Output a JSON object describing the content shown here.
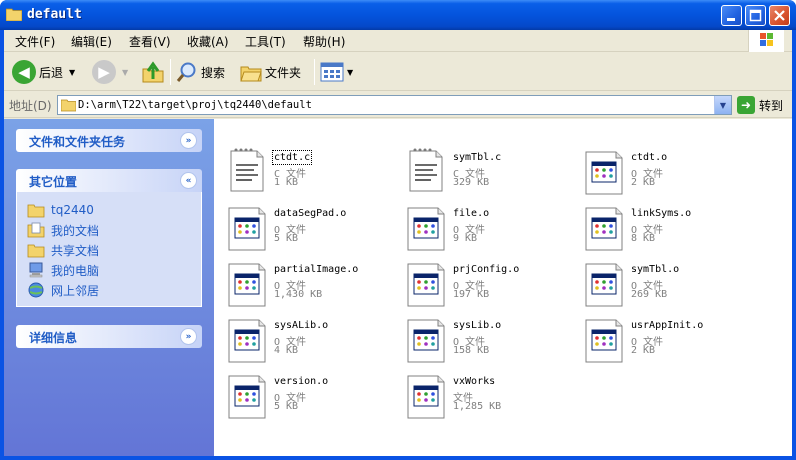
{
  "window": {
    "title": "default"
  },
  "menu": [
    "文件(F)",
    "编辑(E)",
    "查看(V)",
    "收藏(A)",
    "工具(T)",
    "帮助(H)"
  ],
  "toolbar": {
    "back": "后退",
    "search": "搜索",
    "folders": "文件夹"
  },
  "address": {
    "label": "地址(D)",
    "path": "D:\\arm\\T22\\target\\proj\\tq2440\\default",
    "go": "转到"
  },
  "tasks": {
    "title": "文件和文件夹任务"
  },
  "places": {
    "title": "其它位置",
    "items": [
      {
        "label": "tq2440",
        "icon": "folder-icon"
      },
      {
        "label": "我的文档",
        "icon": "my-documents-icon"
      },
      {
        "label": "共享文档",
        "icon": "shared-folder-icon"
      },
      {
        "label": "我的电脑",
        "icon": "my-computer-icon"
      },
      {
        "label": "网上邻居",
        "icon": "network-icon"
      }
    ]
  },
  "details": {
    "title": "详细信息"
  },
  "files": [
    {
      "name": "ctdt.c",
      "type": "C 文件",
      "size": "1 KB",
      "kind": "c"
    },
    {
      "name": "symTbl.c",
      "type": "C 文件",
      "size": "329 KB",
      "kind": "c"
    },
    {
      "name": "ctdt.o",
      "type": "O 文件",
      "size": "2 KB",
      "kind": "o"
    },
    {
      "name": "dataSegPad.o",
      "type": "O 文件",
      "size": "5 KB",
      "kind": "o"
    },
    {
      "name": "file.o",
      "type": "O 文件",
      "size": "9 KB",
      "kind": "o"
    },
    {
      "name": "linkSyms.o",
      "type": "O 文件",
      "size": "8 KB",
      "kind": "o"
    },
    {
      "name": "partialImage.o",
      "type": "O 文件",
      "size": "1,430 KB",
      "kind": "o"
    },
    {
      "name": "prjConfig.o",
      "type": "O 文件",
      "size": "197 KB",
      "kind": "o"
    },
    {
      "name": "symTbl.o",
      "type": "O 文件",
      "size": "269 KB",
      "kind": "o"
    },
    {
      "name": "sysALib.o",
      "type": "O 文件",
      "size": "4 KB",
      "kind": "o"
    },
    {
      "name": "sysLib.o",
      "type": "O 文件",
      "size": "158 KB",
      "kind": "o"
    },
    {
      "name": "usrAppInit.o",
      "type": "O 文件",
      "size": "2 KB",
      "kind": "o"
    },
    {
      "name": "version.o",
      "type": "O 文件",
      "size": "5 KB",
      "kind": "o"
    },
    {
      "name": "vxWorks",
      "type": "文件",
      "size": "1,285 KB",
      "kind": "o"
    }
  ]
}
